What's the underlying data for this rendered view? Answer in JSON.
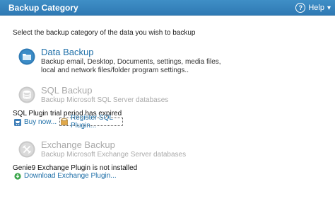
{
  "window": {
    "title": "Backup Category"
  },
  "help": {
    "label": "Help",
    "chevron": "▾"
  },
  "instruction": "Select the backup category of the data you wish to backup",
  "options": {
    "data": {
      "title": "Data Backup",
      "desc_line1": "Backup email, Desktop, Documents, settings, media files,",
      "desc_line2": "local and network files/folder program settings..",
      "icon": "folder-icon"
    },
    "sql": {
      "title": "SQL Backup",
      "desc": "Backup Microsoft SQL Server databases",
      "icon": "database-icon"
    },
    "exchange": {
      "title": "Exchange Backup",
      "desc": "Backup Microsoft Exchange Server databases",
      "icon": "exchange-icon"
    }
  },
  "sql_status": {
    "message": "SQL Plugin trial period has expired",
    "buy_label": "Buy now...",
    "register_label": "Register SQL Plugin..."
  },
  "exchange_status": {
    "message": "Genie9 Exchange Plugin is not installed",
    "download_label": "Download Exchange Plugin..."
  },
  "colors": {
    "titlebar": "#3388c0",
    "accent": "#1e6fa8",
    "disabled": "#a9a9a9"
  }
}
